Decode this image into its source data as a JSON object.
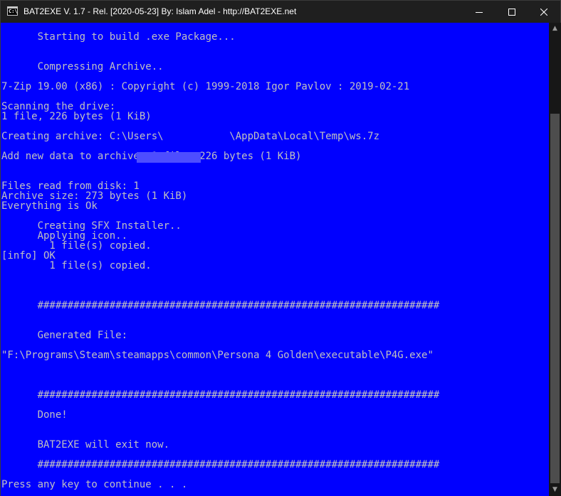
{
  "window": {
    "title": "BAT2EXE V. 1.7 - Rel. [2020-05-23] By: Islam Adel - http://BAT2EXE.net",
    "icon_label": "C:\\",
    "icon": "console-icon",
    "controls": {
      "minimize": "minimize-icon",
      "maximize": "maximize-icon",
      "close": "close-icon"
    }
  },
  "console": {
    "background": "#0000FF",
    "foreground": "#C0C0C0",
    "lines": [
      "      Starting to build .exe Package...",
      "      Compressing Archive..",
      "7-Zip 19.00 (x86) : Copyright (c) 1999-2018 Igor Pavlov : 2019-02-21",
      "Scanning the drive:",
      "1 file, 226 bytes (1 KiB)",
      "Creating archive: C:\\Users\\           \\AppData\\Local\\Temp\\ws.7z",
      "Add new data to archive: 1 file, 226 bytes (1 KiB)",
      "Files read from disk: 1",
      "Archive size: 273 bytes (1 KiB)",
      "Everything is Ok",
      "      Creating SFX Installer..",
      "      Applying icon..",
      "        1 file(s) copied.",
      "[info] OK",
      "        1 file(s) copied.",
      "      ###################################################################",
      "      Generated File:",
      "\"F:\\Programs\\Steam\\steamapps\\common\\Persona 4 Golden\\executable\\P4G.exe\"",
      "      ###################################################################",
      "      Done!",
      "      BAT2EXE will exit now.",
      "      ###################################################################",
      "Press any key to continue . . ."
    ]
  },
  "scrollbar": {
    "up": "▲",
    "down": "▼"
  }
}
